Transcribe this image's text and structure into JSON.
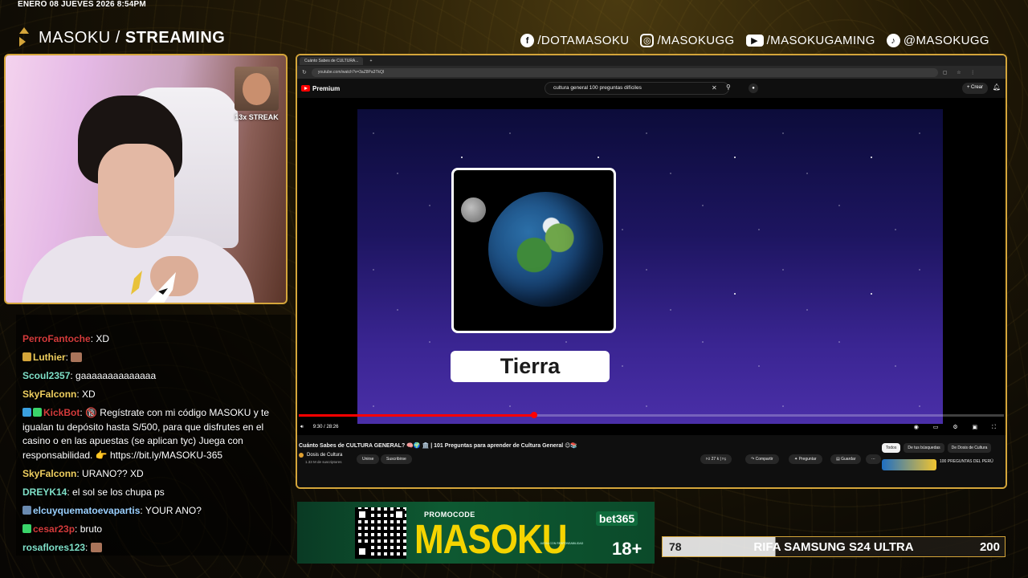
{
  "overlay": {
    "datetime": "ENERO 08 JUEVES 2026 8:54PM",
    "brand_regular": "MASOKU /",
    "brand_bold": "STREAMING",
    "socials": [
      {
        "icon": "facebook-icon",
        "glyph": "f",
        "label": "/DOTAMASOKU"
      },
      {
        "icon": "instagram-icon",
        "glyph": "◎",
        "label": "/MASOKUGG"
      },
      {
        "icon": "youtube-icon",
        "glyph": "▶",
        "label": "/MASOKUGAMING"
      },
      {
        "icon": "tiktok-icon",
        "glyph": "♪",
        "label": "@MASOKUGG"
      }
    ],
    "accent_color": "#d4a53a"
  },
  "webcam": {
    "streak_label": "13x STREAK"
  },
  "chat": {
    "messages": [
      {
        "user": "PerroFantoche",
        "color": "#d43b3b",
        "text": "XD",
        "badges": []
      },
      {
        "user": "Luthier",
        "color": "#f0d060",
        "text": "",
        "badges": [
          "#d4a53a"
        ],
        "emote": true
      },
      {
        "user": "Scoul2357",
        "color": "#7fe0c8",
        "text": "gaaaaaaaaaaaaaa",
        "badges": []
      },
      {
        "user": "SkyFalconn",
        "color": "#f0d060",
        "text": "XD",
        "badges": []
      },
      {
        "user": "KickBot",
        "color": "#d43b3b",
        "text": "🔞 Regístrate con mi código MASOKU y te igualan tu depósito hasta S/500, para que disfrutes en el casino o en las apuestas (se aplican tyc) Juega con responsabilidad. 👉 https://bit.ly/MASOKU-365",
        "badges": [
          "#3aa0e0",
          "#3ad46a"
        ]
      },
      {
        "user": "SkyFalconn",
        "color": "#f0d060",
        "text": "URANO?? XD",
        "badges": []
      },
      {
        "user": "DREYK14",
        "color": "#7fe0c8",
        "text": "el sol se los chupa ps",
        "badges": []
      },
      {
        "user": "elcuyquematoevapartis",
        "color": "#9ad0ff",
        "text": "YOUR ANO?",
        "badges": [
          "#6a8ab0"
        ]
      },
      {
        "user": "cesar23p",
        "color": "#d43b3b",
        "text": "bruto",
        "badges": [
          "#3ad46a"
        ]
      },
      {
        "user": "rosaflores123",
        "color": "#7fe0c8",
        "text": "",
        "badges": [],
        "emote": true
      }
    ]
  },
  "browser": {
    "tab_title": "Cuánto Sabes de CULTURA...",
    "new_tab": "+",
    "url": "youtube.com/watch?v=3aZ8Pa3TkQI"
  },
  "youtube": {
    "logo": "Premium",
    "search_value": "cultura general 100 preguntas difíciles",
    "create_label": "Crear",
    "video_answer": "Tierra",
    "time": "9:30 / 28:26",
    "progress_fraction": 0.334,
    "video_title": "Cuánto Sabes de CULTURA GENERAL? 🧠🌍 🏛️ | 101 Preguntas para aprender de Cultura General 😉📚",
    "channel_name": "Dosis de Cultura",
    "channel_subs": "1.33 M de suscriptores",
    "join_label": "Unirse",
    "subscribed_label": "Suscribirse",
    "likes": "27 k",
    "share_label": "Compartir",
    "ask_label": "Preguntar",
    "save_label": "Guardar",
    "chips": [
      "Todos",
      "De tus búsquedas",
      "De Dosis de Cultura"
    ],
    "rec_title": "100 PREGUNTAS DEL PERÚ"
  },
  "promo": {
    "label": "PROMOCODE",
    "code": "MASOKU",
    "sponsor": "bet365",
    "age": "18+",
    "disclaimer": "JUEGA CON RESPONSABILIDAD"
  },
  "raffle": {
    "current": "78",
    "title": "RIFA SAMSUNG S24 ULTRA",
    "goal": "200"
  }
}
